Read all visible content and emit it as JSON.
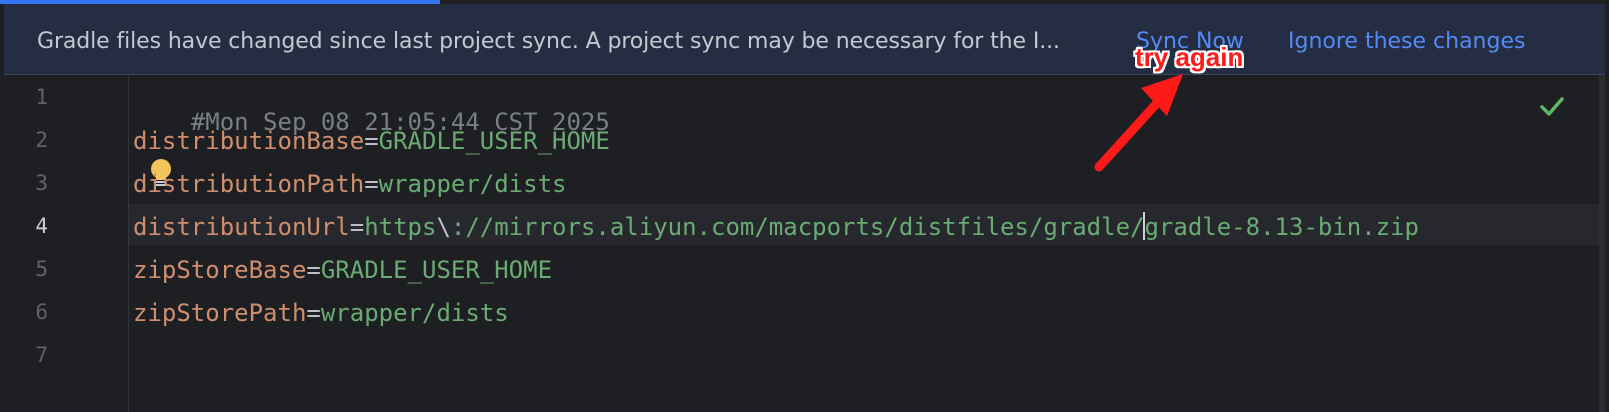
{
  "banner": {
    "message": "Gradle files have changed since last project sync. A project sync may be necessary for the I...",
    "sync_now": "Sync Now",
    "ignore": "Ignore these changes"
  },
  "editor": {
    "line_numbers": [
      "1",
      "2",
      "3",
      "4",
      "5",
      "6",
      "7"
    ],
    "current_line": "4",
    "lines": [
      {
        "comment": "#Mon Sep 08 21:05:44 CST 2025"
      },
      {
        "key": "distributionBase",
        "eq": "=",
        "value": "GRADLE_USER_HOME"
      },
      {
        "key": "distributionPath",
        "eq": "=",
        "value": "wrapper/dists"
      },
      {
        "key": "distributionUrl",
        "eq": "=",
        "value_a": "https",
        "escape": "\\",
        "value_b": "://mirrors.aliyun.com/macports/distfiles/gradle/",
        "value_c": "gradle-8.13-bin.zip"
      },
      {
        "key": "zipStoreBase",
        "eq": "=",
        "value": "GRADLE_USER_HOME"
      },
      {
        "key": "zipStorePath",
        "eq": "=",
        "value": "wrapper/dists"
      },
      {}
    ]
  },
  "annotation": {
    "text": "try again",
    "color": "#ff1a1a"
  },
  "colors": {
    "background": "#1e1f22",
    "banner": "#252d42",
    "link": "#548af7",
    "key": "#cf8e6d",
    "value": "#6aab73",
    "comment": "#7a7e85",
    "check": "#5fb865"
  },
  "icons": [
    "checkmark-icon",
    "lightbulb-icon"
  ]
}
